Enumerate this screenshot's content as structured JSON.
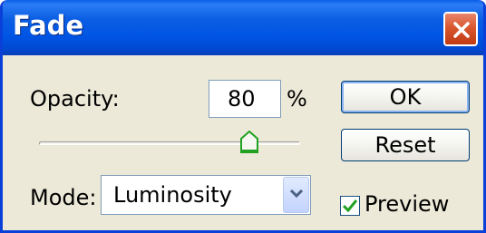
{
  "window": {
    "title": "Fade"
  },
  "opacity": {
    "label": "Opacity:",
    "value": "80",
    "unit": "%",
    "slider_value_percent": 80
  },
  "mode": {
    "label": "Mode:",
    "selected": "Luminosity"
  },
  "buttons": {
    "ok": "OK",
    "reset": "Reset"
  },
  "preview": {
    "label": "Preview",
    "checked": true
  },
  "icons": {
    "close": "close-icon",
    "dropdown": "chevron-down-icon",
    "checkmark": "checkmark-icon",
    "slider_thumb": "slider-thumb-icon"
  },
  "colors": {
    "titlebar": "#0055e5",
    "close_button": "#d9572f",
    "dialog_background": "#ece9d8",
    "checkmark": "#21a121"
  }
}
